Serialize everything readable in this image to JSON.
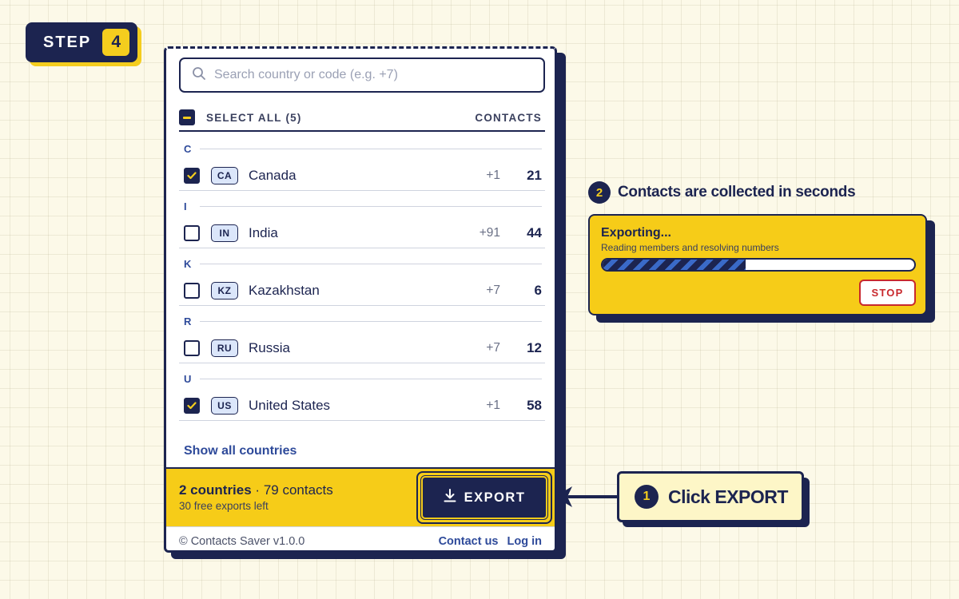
{
  "step_badge": {
    "label": "STEP",
    "number": "4"
  },
  "popup": {
    "search": {
      "placeholder": "Search country or code (e.g. +7)",
      "icon": "search-icon"
    },
    "header": {
      "select_all_label": "SELECT ALL (5)",
      "select_all_state": "partial",
      "contacts_column": "CONTACTS"
    },
    "groups": [
      {
        "letter": "C",
        "rows": [
          {
            "code": "CA",
            "name": "Canada",
            "dial": "+1",
            "count": "21",
            "checked": true
          }
        ]
      },
      {
        "letter": "I",
        "rows": [
          {
            "code": "IN",
            "name": "India",
            "dial": "+91",
            "count": "44",
            "checked": false
          }
        ]
      },
      {
        "letter": "K",
        "rows": [
          {
            "code": "KZ",
            "name": "Kazakhstan",
            "dial": "+7",
            "count": "6",
            "checked": false
          }
        ]
      },
      {
        "letter": "R",
        "rows": [
          {
            "code": "RU",
            "name": "Russia",
            "dial": "+7",
            "count": "12",
            "checked": false
          }
        ]
      },
      {
        "letter": "U",
        "rows": [
          {
            "code": "US",
            "name": "United States",
            "dial": "+1",
            "count": "58",
            "checked": true
          }
        ]
      }
    ],
    "show_all_link": "Show all countries",
    "footer": {
      "selected_countries": "2 countries",
      "separator": " · ",
      "contacts_total": "79 contacts",
      "free_exports": "30 free exports left",
      "export_button": "EXPORT",
      "export_icon": "download-icon"
    },
    "bottom": {
      "copyright": "© Contacts Saver v1.0.0",
      "contact_link": "Contact us",
      "login_link": "Log in"
    }
  },
  "callout_export": {
    "number": "1",
    "text": "Click EXPORT"
  },
  "callout_progress": {
    "number": "2",
    "title": "Contacts are collected in seconds",
    "card_title": "Exporting...",
    "card_subtitle": "Reading members and resolving numbers",
    "progress_fraction": 0.46,
    "stop_button": "STOP"
  },
  "colors": {
    "navy": "#1c2450",
    "yellow": "#f6cc18",
    "link_blue": "#2e4a9a",
    "code_badge_bg": "#dbe6fa",
    "stop_red": "#c8282d",
    "page_bg": "#fcf9e8"
  }
}
